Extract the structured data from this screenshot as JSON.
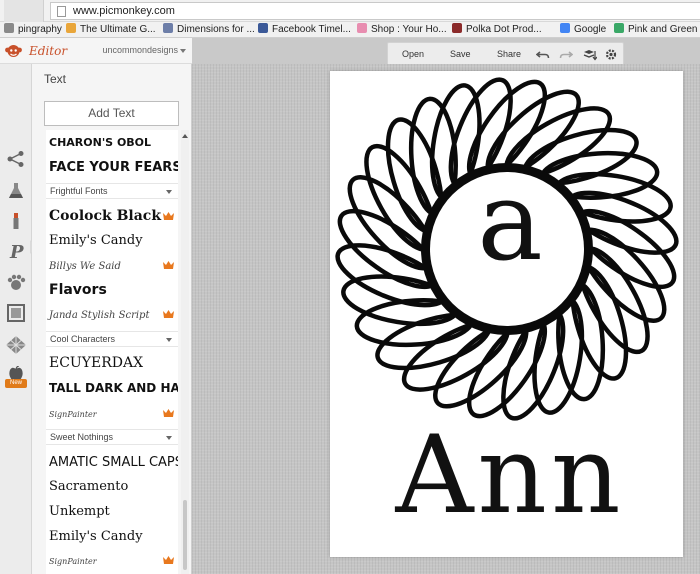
{
  "browser": {
    "url": "www.picmonkey.com",
    "bookmarks": [
      {
        "label": "pingraphy",
        "color": "#8a8a8a"
      },
      {
        "label": "The Ultimate G...",
        "color": "#e9a63a"
      },
      {
        "label": "Dimensions for ...",
        "color": "#6d7ea8"
      },
      {
        "label": "Facebook Timel...",
        "color": "#3b5998"
      },
      {
        "label": "Shop : Your Ho...",
        "color": "#e88db0"
      },
      {
        "label": "Polka Dot Prod...",
        "color": "#8b2a2a"
      },
      {
        "label": "Google",
        "color": "#4285f4"
      },
      {
        "label": "Pink and Green ...",
        "color": "#3aa867"
      }
    ]
  },
  "header": {
    "app_name": "Editor",
    "user": "uncommondesigns",
    "logo_icon": "picmonkey-logo-icon"
  },
  "toolbar": {
    "open": "Open",
    "save": "Save",
    "share": "Share",
    "icons": [
      "undo-icon",
      "redo-icon",
      "layers-icon",
      "settings-icon"
    ]
  },
  "rail": {
    "icons": [
      "basic-edits-icon",
      "effects-icon",
      "touch-up-icon",
      "text-icon",
      "overlays-icon",
      "frames-icon",
      "textures-icon",
      "themes-icon"
    ],
    "new_badge": "New"
  },
  "panel": {
    "title": "Text",
    "add_text": "Add Text"
  },
  "fonts": [
    {
      "type": "font",
      "label": "Charon's Obol",
      "size": 11,
      "weight": "bold",
      "family": "\"DejaVu Sans\", sans-serif",
      "transform": "uppercase",
      "crown": false
    },
    {
      "type": "font",
      "label": "Face Your Fears",
      "size": 13,
      "weight": "bold",
      "family": "\"DejaVu Sans\", sans-serif",
      "transform": "uppercase",
      "crown": false
    },
    {
      "type": "section",
      "label": "Frightful Fonts"
    },
    {
      "type": "font",
      "label": "Coolock Black",
      "size": 14,
      "weight": "bold",
      "family": "\"DejaVu Serif\", serif",
      "transform": "none",
      "crown": true
    },
    {
      "type": "font",
      "label": "Emily's Candy",
      "size": 13,
      "weight": "normal",
      "family": "\"DejaVu Serif\", serif",
      "transform": "none",
      "crown": false
    },
    {
      "type": "font",
      "label": "Billys We Said",
      "size": 10,
      "weight": "normal",
      "family": "\"DejaVu Serif\", serif",
      "transform": "none",
      "crown": true
    },
    {
      "type": "font",
      "label": "Flavors",
      "size": 14,
      "weight": "bold",
      "family": "\"DejaVu Sans\", sans-serif",
      "transform": "none",
      "crown": false
    },
    {
      "type": "font",
      "label": "Janda Stylish Script",
      "size": 10,
      "weight": "normal",
      "family": "\"DejaVu Serif\", serif",
      "transform": "none",
      "crown": true
    },
    {
      "type": "section",
      "label": "Cool Characters"
    },
    {
      "type": "font",
      "label": "EcuyerDAX",
      "size": 14,
      "weight": "normal",
      "family": "\"DejaVu Serif\", serif",
      "transform": "uppercase",
      "crown": false
    },
    {
      "type": "font",
      "label": "Tall Dark and Handsome",
      "size": 12,
      "weight": "bold",
      "family": "\"DejaVu Sans\", sans-serif",
      "transform": "uppercase",
      "crown": false
    },
    {
      "type": "font",
      "label": "SignPainter",
      "size": 8,
      "weight": "normal",
      "family": "\"DejaVu Serif\", serif",
      "transform": "none",
      "crown": true
    },
    {
      "type": "section",
      "label": "Sweet Nothings"
    },
    {
      "type": "font",
      "label": "Amatic Small Caps",
      "size": 13,
      "weight": "normal",
      "family": "\"DejaVu Sans\", sans-serif",
      "transform": "uppercase",
      "crown": false
    },
    {
      "type": "font",
      "label": "Sacramento",
      "size": 13,
      "weight": "normal",
      "family": "\"DejaVu Serif\", serif",
      "transform": "none",
      "crown": false
    },
    {
      "type": "font",
      "label": "Unkempt",
      "size": 13,
      "weight": "normal",
      "family": "\"DejaVu Serif\", serif",
      "transform": "none",
      "crown": false
    },
    {
      "type": "font",
      "label": "Emily's Candy",
      "size": 13,
      "weight": "normal",
      "family": "\"DejaVu Serif\", serif",
      "transform": "none",
      "crown": false
    },
    {
      "type": "font",
      "label": "SignPainter",
      "size": 8,
      "weight": "normal",
      "family": "\"DejaVu Serif\", serif",
      "transform": "none",
      "crown": true
    }
  ],
  "canvas": {
    "monogram_letter": "a",
    "name": "Ann",
    "design_icon": "spirograph-wreath-icon"
  },
  "colors": {
    "accent": "#c8502a",
    "crown": "#e8781e",
    "new_badge": "#e07b1a"
  }
}
